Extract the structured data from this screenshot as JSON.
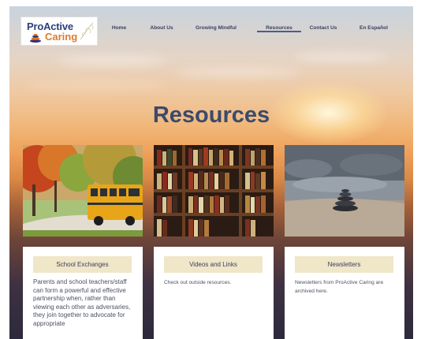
{
  "brand": {
    "line1": "ProActive",
    "line2": "Caring"
  },
  "nav": {
    "items": [
      {
        "label": "Home"
      },
      {
        "label": "About Us"
      },
      {
        "label": "Growing Mindful"
      },
      {
        "label": "Resources",
        "active": true
      },
      {
        "label": "Contact Us"
      },
      {
        "label": "En Español"
      }
    ]
  },
  "page": {
    "title": "Resources"
  },
  "cards": [
    {
      "title": "School Exchanges",
      "text": "Parents and school teachers/staff can form a powerful and effective partnership when, rather than viewing each other as adversaries, they join together to advocate for appropriate"
    },
    {
      "title": "Videos and Links",
      "text": "Check out outside resources."
    },
    {
      "title": "Newsletters",
      "text": "Newsletters from ProActive Caring are archived here."
    }
  ],
  "colors": {
    "accent": "#4b5c86",
    "tag_bg": "#f0e6c8",
    "title": "#3b4a6b",
    "logo_orange": "#e07b2a"
  }
}
